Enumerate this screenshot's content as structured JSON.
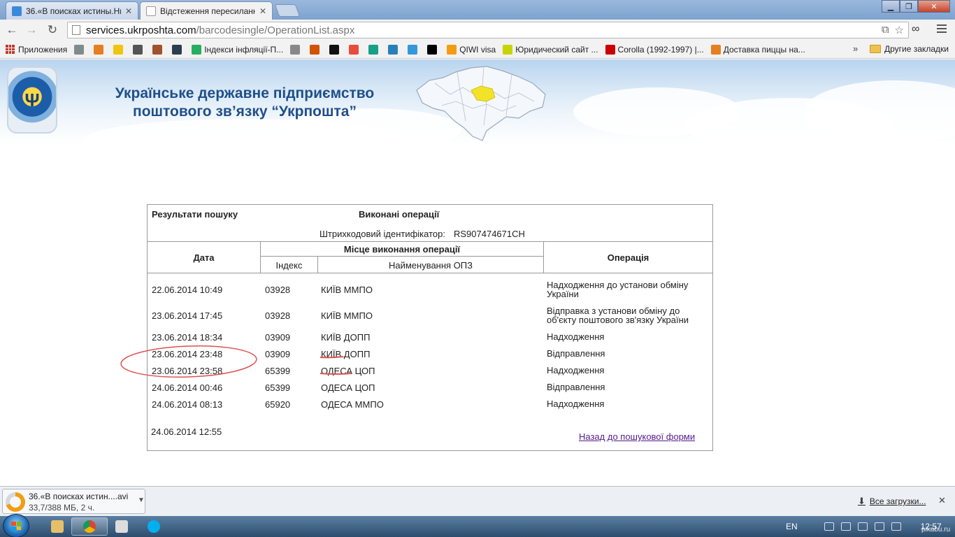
{
  "browser": {
    "tabs": [
      {
        "title": "36.«В поисках истины.Ни",
        "active": false
      },
      {
        "title": "Відстеження пересиланн",
        "active": true
      }
    ],
    "url_host": "services.ukrposhta.com",
    "url_path": "/barcodesingle/OperationList.aspx",
    "bookmarks": [
      {
        "label": "Приложения",
        "color": "#c0392b"
      },
      {
        "label": "",
        "color": "#7f8c8d"
      },
      {
        "label": "",
        "color": "#e67e22"
      },
      {
        "label": "",
        "color": "#f1c40f"
      },
      {
        "label": "",
        "color": "#555555"
      },
      {
        "label": "",
        "color": "#a0522d"
      },
      {
        "label": "",
        "color": "#2c3e50"
      },
      {
        "label": "Індекси інфляції-П...",
        "color": "#27ae60"
      },
      {
        "label": "",
        "color": "#888888"
      },
      {
        "label": "",
        "color": "#d35400"
      },
      {
        "label": "",
        "color": "#111111"
      },
      {
        "label": "",
        "color": "#e74c3c"
      },
      {
        "label": "",
        "color": "#16a085"
      },
      {
        "label": "",
        "color": "#2980b9"
      },
      {
        "label": "",
        "color": "#3498db"
      },
      {
        "label": "",
        "color": "#000000"
      },
      {
        "label": "QIWI visa",
        "color": "#f39c12"
      },
      {
        "label": "Юридический сайт ...",
        "color": "#c8d400"
      },
      {
        "label": "Corolla (1992-1997) |...",
        "color": "#cc0000"
      },
      {
        "label": "Доставка пиццы на...",
        "color": "#e67e22"
      }
    ],
    "bookmarks_more": "»",
    "other_bookmarks": "Другие закладки"
  },
  "header": {
    "org_line1": "Українське державне підприємство",
    "org_line2": "поштового зв’язку “Укрпошта”"
  },
  "results": {
    "title": "Результати пошуку",
    "subtitle": "Виконані операції",
    "barcode_label": "Штрихкодовий ідентифікатор:",
    "barcode_value": "RS907474671CH",
    "columns": {
      "date": "Дата",
      "place": "Місце виконання операції",
      "index": "Індекс",
      "name": "Найменування ОПЗ",
      "operation": "Операція"
    },
    "rows": [
      {
        "date": "22.06.2014 10:49",
        "index": "03928",
        "name": "КИЇВ ММПО",
        "operation": "Надходження до установи обміну України"
      },
      {
        "date": "23.06.2014 17:45",
        "index": "03928",
        "name": "КИЇВ ММПО",
        "operation": "Відправка з установи обміну до об'єкту поштового зв'язку України"
      },
      {
        "date": "23.06.2014 18:34",
        "index": "03909",
        "name": "КИЇВ ДОПП",
        "operation": "Надходження"
      },
      {
        "date": "23.06.2014 23:48",
        "index": "03909",
        "name": "КИЇВ ДОПП",
        "operation": "Відправлення"
      },
      {
        "date": "23.06.2014 23:58",
        "index": "65399",
        "name": "ОДЕСА ЦОП",
        "operation": "Надходження"
      },
      {
        "date": "24.06.2014 00:46",
        "index": "65399",
        "name": "ОДЕСА ЦОП",
        "operation": "Відправлення"
      },
      {
        "date": "24.06.2014 08:13",
        "index": "65920",
        "name": "ОДЕСА ММПО",
        "operation": "Надходження"
      }
    ],
    "timestamp": "24.06.2014 12:55",
    "back_link": "Назад до пошукової форми"
  },
  "downloads": {
    "file_name": "36.«В поисках истин....avi",
    "status": "33,7/388 МБ, 2 ч.",
    "show_all": "Все загрузки..."
  },
  "taskbar": {
    "lang": "EN",
    "clock": "12:57",
    "watermark": "pikabu.ru"
  },
  "colors": {
    "annotation": "#d9534f",
    "org_text": "#1f4f8a",
    "visited_link": "#551a8b"
  }
}
